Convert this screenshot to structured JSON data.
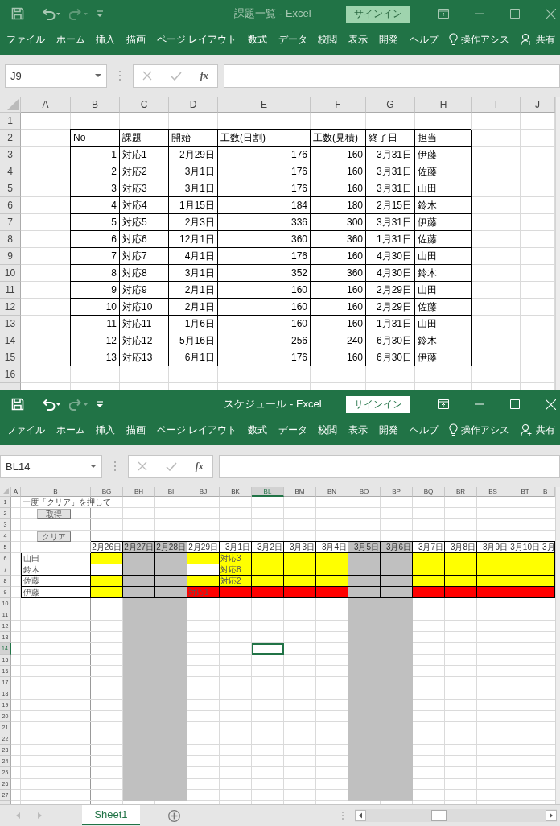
{
  "windows": [
    {
      "kind": "task_list",
      "active": false,
      "title": "課題一覧 - Excel",
      "sign_in": "サインイン",
      "tabs": [
        "ファイル",
        "ホーム",
        "挿入",
        "描画",
        "ページ レイアウト",
        "数式",
        "データ",
        "校閲",
        "表示",
        "開発",
        "ヘルプ"
      ],
      "tell_me": "操作アシス",
      "share": "共有",
      "name_box": "J9",
      "function_label": "fx",
      "sheet": {
        "columns": [
          "A",
          "B",
          "C",
          "D",
          "E",
          "F",
          "G",
          "H",
          "I",
          "J"
        ],
        "row_numbers": [
          "1",
          "2",
          "3",
          "4",
          "5",
          "6",
          "7",
          "8",
          "9",
          "10",
          "11",
          "12",
          "13",
          "14",
          "15",
          "16"
        ],
        "table": {
          "headers": [
            "No",
            "課題",
            "開始",
            "工数(日割)",
            "工数(見積)",
            "終了日",
            "担当"
          ],
          "rows": [
            [
              "1",
              "対応1",
              "2月29日",
              "176",
              "160",
              "3月31日",
              "伊藤"
            ],
            [
              "2",
              "対応2",
              "3月1日",
              "176",
              "160",
              "3月31日",
              "佐藤"
            ],
            [
              "3",
              "対応3",
              "3月1日",
              "176",
              "160",
              "3月31日",
              "山田"
            ],
            [
              "4",
              "対応4",
              "1月15日",
              "184",
              "180",
              "2月15日",
              "鈴木"
            ],
            [
              "5",
              "対応5",
              "2月3日",
              "336",
              "300",
              "3月31日",
              "伊藤"
            ],
            [
              "6",
              "対応6",
              "12月1日",
              "360",
              "360",
              "1月31日",
              "佐藤"
            ],
            [
              "7",
              "対応7",
              "4月1日",
              "176",
              "160",
              "4月30日",
              "山田"
            ],
            [
              "8",
              "対応8",
              "3月1日",
              "352",
              "360",
              "4月30日",
              "鈴木"
            ],
            [
              "9",
              "対応9",
              "2月1日",
              "160",
              "160",
              "2月29日",
              "山田"
            ],
            [
              "10",
              "対応10",
              "2月1日",
              "160",
              "160",
              "2月29日",
              "佐藤"
            ],
            [
              "11",
              "対応11",
              "1月6日",
              "160",
              "160",
              "1月31日",
              "山田"
            ],
            [
              "12",
              "対応12",
              "5月16日",
              "256",
              "240",
              "6月30日",
              "鈴木"
            ],
            [
              "13",
              "対応13",
              "6月1日",
              "176",
              "160",
              "6月30日",
              "伊藤"
            ]
          ]
        }
      }
    },
    {
      "kind": "schedule",
      "active": true,
      "title": "スケジュール - Excel",
      "sign_in": "サインイン",
      "tabs": [
        "ファイル",
        "ホーム",
        "挿入",
        "描画",
        "ページ レイアウト",
        "数式",
        "データ",
        "校閲",
        "表示",
        "開発",
        "ヘルプ"
      ],
      "tell_me": "操作アシス",
      "share": "共有",
      "name_box": "BL14",
      "function_label": "fx",
      "sheet": {
        "fixed_columns": [
          "A",
          "B"
        ],
        "date_columns": [
          {
            "letter": "BG",
            "date": "2月26日",
            "holiday": false,
            "selected": false
          },
          {
            "letter": "BH",
            "date": "2月27日",
            "holiday": true,
            "selected": false
          },
          {
            "letter": "BI",
            "date": "2月28日",
            "holiday": true,
            "selected": false
          },
          {
            "letter": "BJ",
            "date": "2月29日",
            "holiday": false,
            "selected": false
          },
          {
            "letter": "BK",
            "date": "3月1日",
            "holiday": false,
            "selected": false
          },
          {
            "letter": "BL",
            "date": "3月2日",
            "holiday": false,
            "selected": true
          },
          {
            "letter": "BM",
            "date": "3月3日",
            "holiday": false,
            "selected": false
          },
          {
            "letter": "BN",
            "date": "3月4日",
            "holiday": false,
            "selected": false
          },
          {
            "letter": "BO",
            "date": "3月5日",
            "holiday": true,
            "selected": false
          },
          {
            "letter": "BP",
            "date": "3月6日",
            "holiday": true,
            "selected": false
          },
          {
            "letter": "BQ",
            "date": "3月7日",
            "holiday": false,
            "selected": false
          },
          {
            "letter": "BR",
            "date": "3月8日",
            "holiday": false,
            "selected": false
          },
          {
            "letter": "BS",
            "date": "3月9日",
            "holiday": false,
            "selected": false
          },
          {
            "letter": "BT",
            "date": "3月10日",
            "holiday": false,
            "selected": false
          },
          {
            "letter": "B",
            "date": "3月",
            "holiday": false,
            "selected": false
          }
        ],
        "row_numbers": [
          {
            "label": "1",
            "selected": false
          },
          {
            "label": "2",
            "selected": false
          },
          {
            "label": "3",
            "selected": false
          },
          {
            "label": "4",
            "selected": false
          },
          {
            "label": "5",
            "selected": false
          },
          {
            "label": "6",
            "selected": false
          },
          {
            "label": "7",
            "selected": false
          },
          {
            "label": "8",
            "selected": false
          },
          {
            "label": "9",
            "selected": false
          },
          {
            "label": "10",
            "selected": false
          },
          {
            "label": "11",
            "selected": false
          },
          {
            "label": "12",
            "selected": false
          },
          {
            "label": "13",
            "selected": false
          },
          {
            "label": "14",
            "selected": true
          },
          {
            "label": "15",
            "selected": false
          },
          {
            "label": "16",
            "selected": false
          },
          {
            "label": "17",
            "selected": false
          },
          {
            "label": "18",
            "selected": false
          },
          {
            "label": "19",
            "selected": false
          },
          {
            "label": "20",
            "selected": false
          },
          {
            "label": "21",
            "selected": false
          },
          {
            "label": "22",
            "selected": false
          },
          {
            "label": "23",
            "selected": false
          },
          {
            "label": "24",
            "selected": false
          },
          {
            "label": "25",
            "selected": false
          },
          {
            "label": "26",
            "selected": false
          },
          {
            "label": "27",
            "selected": false
          }
        ],
        "note": "一度「クリア」を押して",
        "buttons": [
          "取得",
          "クリア"
        ],
        "people": [
          {
            "name": "山田",
            "cells": [
              {
                "color": "#ffff00"
              },
              {
                "color": "#c0c0c0"
              },
              {
                "color": "#c0c0c0"
              },
              {
                "color": "#ffff00"
              },
              {
                "color": "#ffff00",
                "text": "対応3"
              },
              {
                "color": "#ffff00"
              },
              {
                "color": "#ffff00"
              },
              {
                "color": "#ffff00"
              },
              {
                "color": "#c0c0c0"
              },
              {
                "color": "#c0c0c0"
              },
              {
                "color": "#ffff00"
              },
              {
                "color": "#ffff00"
              },
              {
                "color": "#ffff00"
              },
              {
                "color": "#ffff00"
              },
              {
                "color": "#ffff00"
              }
            ]
          },
          {
            "name": "鈴木",
            "cells": [
              {
                "color": "#ffffff"
              },
              {
                "color": "#c0c0c0"
              },
              {
                "color": "#c0c0c0"
              },
              {
                "color": "#ffffff"
              },
              {
                "color": "#ffff00",
                "text": "対応8"
              },
              {
                "color": "#ffff00"
              },
              {
                "color": "#ffff00"
              },
              {
                "color": "#ffff00"
              },
              {
                "color": "#c0c0c0"
              },
              {
                "color": "#c0c0c0"
              },
              {
                "color": "#ffff00"
              },
              {
                "color": "#ffff00"
              },
              {
                "color": "#ffff00"
              },
              {
                "color": "#ffff00"
              },
              {
                "color": "#ffff00"
              }
            ]
          },
          {
            "name": "佐藤",
            "cells": [
              {
                "color": "#ffff00"
              },
              {
                "color": "#c0c0c0"
              },
              {
                "color": "#c0c0c0"
              },
              {
                "color": "#ffff00"
              },
              {
                "color": "#ffff00",
                "text": "対応2"
              },
              {
                "color": "#ffff00"
              },
              {
                "color": "#ffff00"
              },
              {
                "color": "#ffff00"
              },
              {
                "color": "#c0c0c0"
              },
              {
                "color": "#c0c0c0"
              },
              {
                "color": "#ffff00"
              },
              {
                "color": "#ffff00"
              },
              {
                "color": "#ffff00"
              },
              {
                "color": "#ffff00"
              },
              {
                "color": "#ffff00"
              }
            ]
          },
          {
            "name": "伊藤",
            "cells": [
              {
                "color": "#ffff00"
              },
              {
                "color": "#c0c0c0"
              },
              {
                "color": "#c0c0c0"
              },
              {
                "color": "#ff0000",
                "text": "対応1"
              },
              {
                "color": "#ff0000"
              },
              {
                "color": "#ff0000"
              },
              {
                "color": "#ff0000"
              },
              {
                "color": "#ff0000"
              },
              {
                "color": "#c0c0c0"
              },
              {
                "color": "#c0c0c0"
              },
              {
                "color": "#ff0000"
              },
              {
                "color": "#ff0000"
              },
              {
                "color": "#ff0000"
              },
              {
                "color": "#ff0000"
              },
              {
                "color": "#ff0000"
              }
            ]
          }
        ]
      },
      "sheet_tab": "Sheet1"
    }
  ]
}
